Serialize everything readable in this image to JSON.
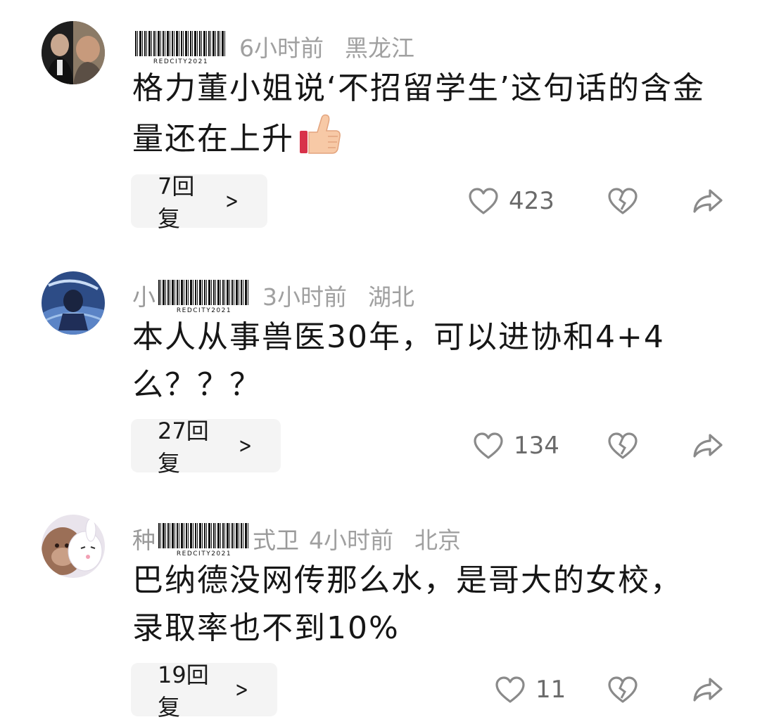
{
  "comments": [
    {
      "user": {
        "prefix": "",
        "suffix": "",
        "watermark": "REDCITY2021"
      },
      "time": "6小时前",
      "location": "黑龙江",
      "text": "格力董小姐说‘不招留学生’这句话的含金量还在上升",
      "emoji": "thumbs-up",
      "reply_label": "7回复",
      "likes": "423"
    },
    {
      "user": {
        "prefix": "小",
        "suffix": "",
        "watermark": "REDCITY2021"
      },
      "time": "3小时前",
      "location": "湖北",
      "text": "本人从事兽医30年，可以进协和4+4么？？？",
      "reply_label": "27回复",
      "likes": "134"
    },
    {
      "user": {
        "prefix": "种",
        "suffix": "式卫",
        "watermark": "REDCITY2021"
      },
      "time": "4小时前",
      "location": "北京",
      "text": "巴纳德没网传那么水，是哥大的女校，录取率也不到10%",
      "reply_label": "19回复",
      "likes": "11"
    }
  ],
  "colors": {
    "background": "#ffffff",
    "meta_text": "#a0a0a0",
    "reply_bg": "#f4f4f4",
    "icon": "#8a8a8a"
  },
  "icons": {
    "like": "heart-outline-icon",
    "dislike": "broken-heart-icon",
    "share": "share-arrow-icon"
  }
}
